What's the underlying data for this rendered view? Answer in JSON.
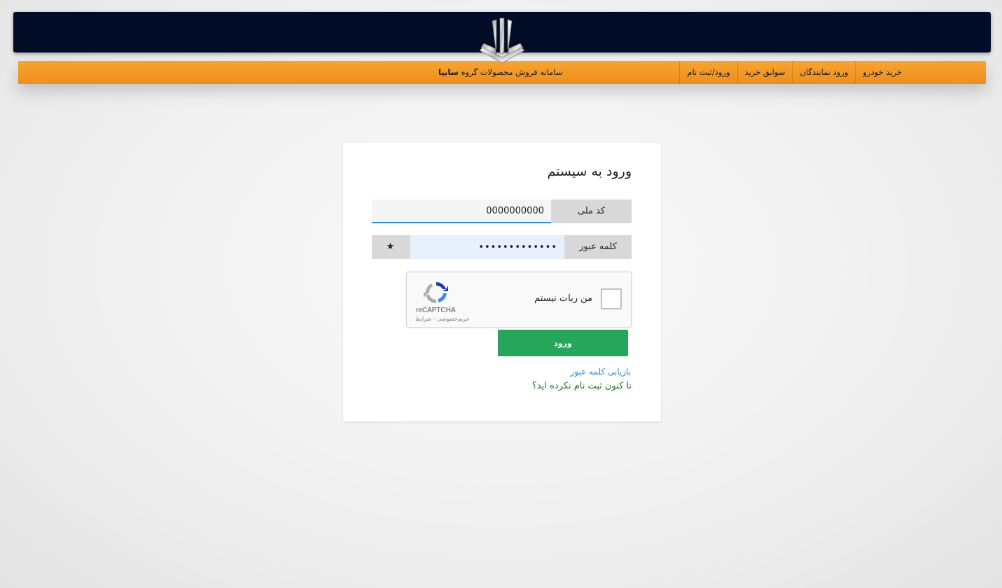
{
  "header": {
    "nav": [
      {
        "label": "خرید خودرو"
      },
      {
        "label": "ورود نمایندگان"
      },
      {
        "label": "سوابق خرید"
      },
      {
        "label": "ورود/ثبت نام"
      }
    ],
    "site_title_prefix": "سامانه فروش محصولات گروه ",
    "site_title_brand": "سایپا"
  },
  "login": {
    "title": "ورود به سیستم",
    "national_id_label": "کد ملی",
    "national_id_value": "0000000000",
    "password_label": "کلمه عبور",
    "password_value": "•••••••••••••",
    "password_toggle": "★",
    "captcha": {
      "label": "من ربات نیستم",
      "brand": "reCAPTCHA",
      "links": "حریم‌خصوصی - شرایط"
    },
    "submit_label": "ورود",
    "forgot_password": "بازیابی کلمه عبور",
    "register_prompt": "تا کنون ثبت نام نکرده اید؟"
  },
  "colors": {
    "header_bg": "#010d26",
    "nav_bg": "#f39a2a",
    "submit_bg": "#26a65b",
    "link_blue": "#2b8ad3",
    "link_green": "#1b7a2a"
  }
}
